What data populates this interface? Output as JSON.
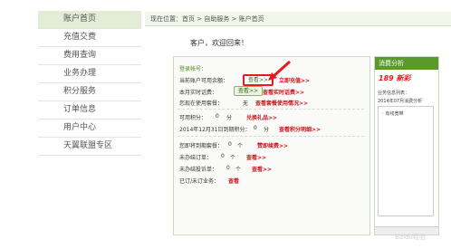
{
  "sidebar": {
    "items": [
      {
        "label": "账户首页",
        "active": true
      },
      {
        "label": "充值交费",
        "active": false
      },
      {
        "label": "费用查询",
        "active": false
      },
      {
        "label": "业务办理",
        "active": false
      },
      {
        "label": "积分服务",
        "active": false
      },
      {
        "label": "订单信息",
        "active": false
      },
      {
        "label": "用户中心",
        "active": false
      },
      {
        "label": "天翼联盟专区",
        "active": false
      }
    ]
  },
  "breadcrumb": "现在位置：首页 > 自助服务 > 账户首页",
  "welcome": "客户，欢迎回来！",
  "account": {
    "label_account": "登录帐号：",
    "label_balance": "当前账户可用余额：",
    "view_btn": "查看>>",
    "recharge_link": "立即充值>>",
    "label_realtime": "本月实时话费：",
    "realtime_view_btn": "查看>>",
    "realtime_link": "查看实时话费>>",
    "label_package": "您现在使用套餐：",
    "package_value": "无",
    "package_link": "查看套餐使用情况>>"
  },
  "points": {
    "label_available": "可用积分：",
    "available_value": "0",
    "available_unit": "分",
    "redeem_link": "兑换礼品>>",
    "label_expire": "2014年12月31日到期积分：",
    "expire_value": "0",
    "expire_unit": "分",
    "expire_link": "查看积分明细>>"
  },
  "orders": {
    "label_gift": "您即将到期套餐：",
    "gift_value": "0",
    "gift_unit": "个",
    "gift_link": "赞即续费>>",
    "label_unfinished": "未办结订单：",
    "unfinished_value": "0",
    "unfinished_unit": "个",
    "unfinished_link": "查看>>",
    "label_complaint": "未办结投诉单：",
    "complaint_value": "0",
    "complaint_unit": "个",
    "complaint_link": "查看>>",
    "label_done": "已订/未订业务：",
    "done_link": "查看"
  },
  "consumption": {
    "title": "消费分析",
    "brand_prefix": "189",
    "brand_suffix": "新彩",
    "info_label": "业务信息列表：",
    "period": "2014年07月消费分析",
    "legend_item": "有线宽带"
  },
  "watermark": "Baidu经验"
}
